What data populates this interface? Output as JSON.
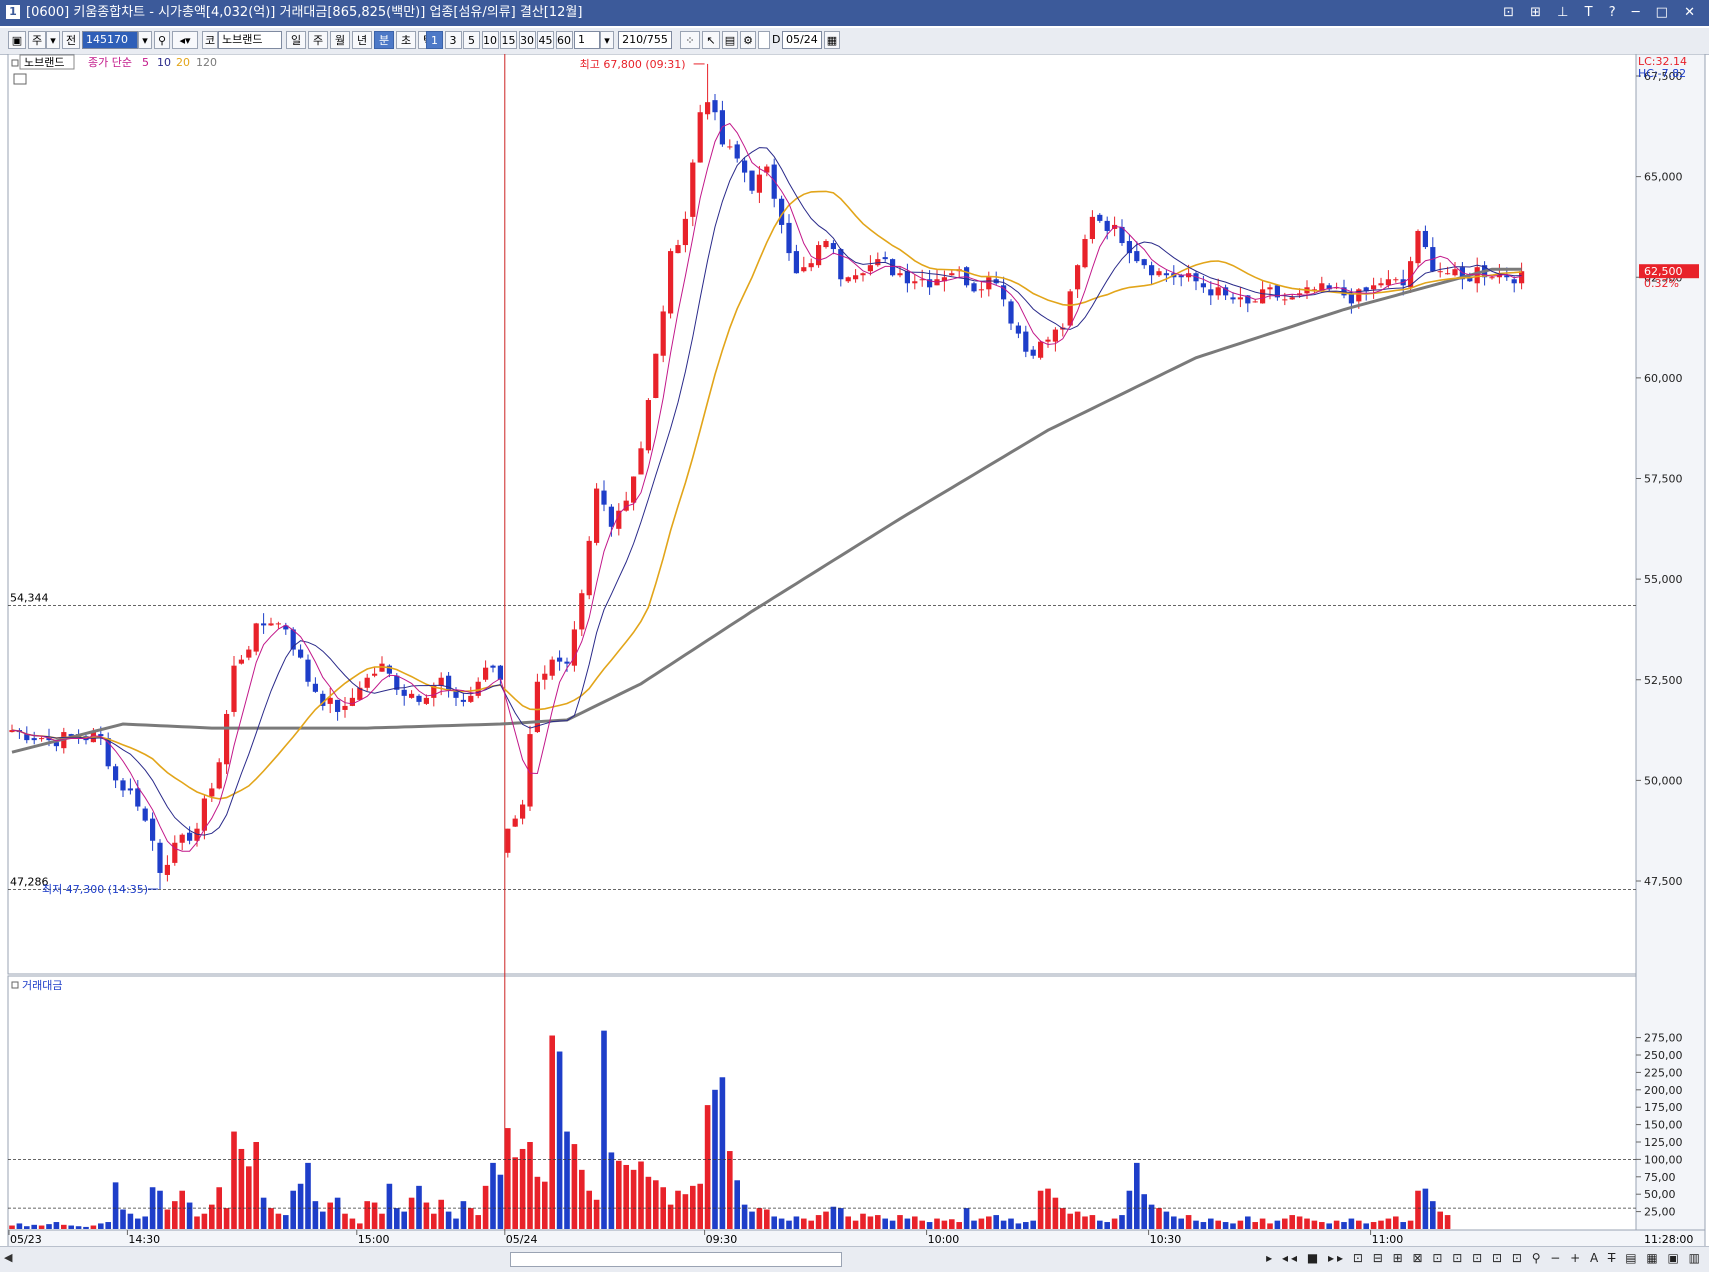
{
  "window": {
    "title": "[0600] 키움종합차트 - 시가총액[4,032(억)] 거래대금[865,825(백만)] 업종[섬유/의류] 결산[12월]",
    "icon_label": "1",
    "buttons": "⊡ ⊞ ⊥ T ? ─ □ ✕"
  },
  "toolbar": {
    "menu_label": "주",
    "prev_label": "전",
    "code": "145170",
    "market_label": "코",
    "stock_name": "노브랜드",
    "period_buttons": [
      "일",
      "주",
      "월",
      "년",
      "분",
      "초",
      "틱"
    ],
    "selected_period": "분",
    "interval_buttons": [
      "1",
      "3",
      "5",
      "10",
      "15",
      "30",
      "45",
      "60"
    ],
    "selected_interval": "1",
    "interval_input": "1",
    "count": "210/755",
    "date_prefix": "D",
    "date": "05/24"
  },
  "legend": {
    "stock": "노브랜드",
    "ma_label": "종가 단순",
    "ma_periods": [
      "5",
      "10",
      "20",
      "120"
    ],
    "volume_title": "거래대금"
  },
  "annotations": {
    "high": "최고 67,800 (09:31)",
    "low": "최저 47,300 (14:35)",
    "level_upper": "54,344",
    "level_lower": "47,286",
    "lc": "LC:32.14",
    "hc": "HC:-7.82",
    "current_price": "62,500",
    "current_change": "0.32%",
    "current_time": "11:28:00"
  },
  "colors": {
    "up": "#e8222a",
    "down": "#1e3ec9",
    "ma5": "#c2188a",
    "ma10": "#2a2a8a",
    "ma20": "#e2a51a",
    "ma120": "#7a7a7a",
    "session_line": "#cc2222"
  },
  "chart_data": [
    {
      "type": "candlestick",
      "title": "노브랜드",
      "y_ticks": [
        "67,500",
        "65,000",
        "62,500",
        "60,000",
        "57,500",
        "55,000",
        "52,500",
        "50,000",
        "47,500"
      ],
      "ylim": [
        47000,
        68400
      ],
      "x_ticks": [
        "05/23",
        "14:30",
        "15:00",
        "05/24",
        "09:30",
        "10:00",
        "10:30",
        "11:00"
      ],
      "x_tick_bars": [
        0,
        16,
        47,
        67,
        94,
        124,
        154,
        184
      ],
      "session_break_bar": 67,
      "high": {
        "value": 67800,
        "time": "09:31",
        "bar": 94
      },
      "low": {
        "value": 47300,
        "time": "14:35",
        "bar": 20
      },
      "horizontal_levels": [
        54344,
        47286
      ],
      "ma_periods": [
        5,
        10,
        20,
        120
      ],
      "keypoints": [
        [
          0,
          51250
        ],
        [
          5,
          51000
        ],
        [
          10,
          51100
        ],
        [
          12,
          51050
        ],
        [
          14,
          50000
        ],
        [
          17,
          49500
        ],
        [
          19,
          48500
        ],
        [
          20,
          47800
        ],
        [
          22,
          48300
        ],
        [
          25,
          48800
        ],
        [
          28,
          50500
        ],
        [
          30,
          52800
        ],
        [
          33,
          53700
        ],
        [
          35,
          54000
        ],
        [
          37,
          53800
        ],
        [
          40,
          52500
        ],
        [
          42,
          52000
        ],
        [
          45,
          51700
        ],
        [
          47,
          52400
        ],
        [
          50,
          52800
        ],
        [
          53,
          52200
        ],
        [
          55,
          52100
        ],
        [
          58,
          52500
        ],
        [
          60,
          51900
        ],
        [
          62,
          52100
        ],
        [
          64,
          52800
        ],
        [
          66,
          52500
        ],
        [
          67,
          48800
        ],
        [
          69,
          49500
        ],
        [
          71,
          52600
        ],
        [
          73,
          52900
        ],
        [
          75,
          52700
        ],
        [
          77,
          54500
        ],
        [
          79,
          57200
        ],
        [
          81,
          56500
        ],
        [
          83,
          57000
        ],
        [
          85,
          58300
        ],
        [
          87,
          60500
        ],
        [
          89,
          63000
        ],
        [
          91,
          64000
        ],
        [
          93,
          66600
        ],
        [
          94,
          67000
        ],
        [
          96,
          65800
        ],
        [
          98,
          65400
        ],
        [
          100,
          64800
        ],
        [
          102,
          65100
        ],
        [
          104,
          64000
        ],
        [
          106,
          62500
        ],
        [
          108,
          62800
        ],
        [
          110,
          63500
        ],
        [
          112,
          62600
        ],
        [
          115,
          62800
        ],
        [
          118,
          62800
        ],
        [
          121,
          62500
        ],
        [
          124,
          62400
        ],
        [
          127,
          62700
        ],
        [
          130,
          62300
        ],
        [
          133,
          62500
        ],
        [
          135,
          61500
        ],
        [
          137,
          60700
        ],
        [
          139,
          60800
        ],
        [
          142,
          61300
        ],
        [
          144,
          62700
        ],
        [
          146,
          64100
        ],
        [
          148,
          63800
        ],
        [
          150,
          63500
        ],
        [
          152,
          63000
        ],
        [
          155,
          62600
        ],
        [
          158,
          62500
        ],
        [
          161,
          62300
        ],
        [
          164,
          62000
        ],
        [
          167,
          61800
        ],
        [
          170,
          62100
        ],
        [
          173,
          61900
        ],
        [
          176,
          62200
        ],
        [
          179,
          62100
        ],
        [
          182,
          62000
        ],
        [
          185,
          62400
        ],
        [
          188,
          62300
        ],
        [
          189,
          62900
        ],
        [
          190,
          63500
        ],
        [
          192,
          62800
        ],
        [
          194,
          62600
        ],
        [
          196,
          62400
        ],
        [
          198,
          62700
        ],
        [
          200,
          62600
        ],
        [
          204,
          62500
        ]
      ],
      "ma120_keypoints": [
        [
          0,
          50700
        ],
        [
          15,
          51400
        ],
        [
          27,
          51300
        ],
        [
          48,
          51300
        ],
        [
          66,
          51400
        ],
        [
          75,
          51500
        ],
        [
          85,
          52400
        ],
        [
          100,
          54200
        ],
        [
          120,
          56500
        ],
        [
          140,
          58700
        ],
        [
          160,
          60500
        ],
        [
          180,
          61700
        ],
        [
          200,
          62700
        ],
        [
          204,
          62700
        ]
      ],
      "bar_count": 205
    },
    {
      "type": "bar",
      "title": "거래대금",
      "y_ticks": [
        "275,00",
        "250,00",
        "225,00",
        "200,00",
        "175,00",
        "150,00",
        "125,00",
        "100,00",
        "75,00",
        "50,00",
        "25,00"
      ],
      "ylim": [
        0,
        290
      ],
      "reference_lines": [
        100,
        30
      ],
      "series": [
        {
          "name": "거래대금",
          "values": [
            5,
            8,
            4,
            6,
            5,
            7,
            10,
            6,
            5,
            4,
            3,
            5,
            8,
            10,
            67,
            28,
            22,
            15,
            18,
            60,
            55,
            28,
            40,
            55,
            38,
            18,
            22,
            35,
            60,
            30,
            140,
            115,
            90,
            125,
            45,
            30,
            22,
            20,
            55,
            65,
            95,
            40,
            25,
            38,
            45,
            22,
            15,
            8,
            40,
            38,
            22,
            65,
            30,
            25,
            45,
            62,
            38,
            22,
            42,
            25,
            15,
            40,
            30,
            20,
            62,
            95,
            78,
            145,
            103,
            115,
            125,
            75,
            68,
            278,
            255,
            140,
            122,
            85,
            55,
            42,
            285,
            110,
            98,
            92,
            85,
            97,
            75,
            70,
            60,
            35,
            55,
            50,
            62,
            65,
            178,
            200,
            218,
            112,
            70,
            35,
            25,
            30,
            28,
            18,
            15,
            12,
            18,
            15,
            12,
            20,
            25,
            32,
            30,
            18,
            12,
            22,
            18,
            20,
            15,
            12,
            20,
            15,
            18,
            12,
            10,
            15,
            12,
            14,
            10,
            30,
            12,
            15,
            18,
            20,
            12,
            15,
            8,
            10,
            12,
            55,
            58,
            45,
            30,
            22,
            25,
            18,
            20,
            12,
            10,
            15,
            20,
            55,
            95,
            50,
            35,
            30,
            25,
            18,
            15,
            20,
            12,
            10,
            15,
            12,
            10,
            8,
            12,
            18,
            10,
            15,
            8,
            12,
            15,
            20,
            18,
            15,
            12,
            10,
            8,
            12,
            10,
            15,
            12,
            8,
            10,
            12,
            15,
            18,
            10,
            12,
            55,
            58,
            40,
            25,
            20
          ]
        }
      ]
    }
  ]
}
